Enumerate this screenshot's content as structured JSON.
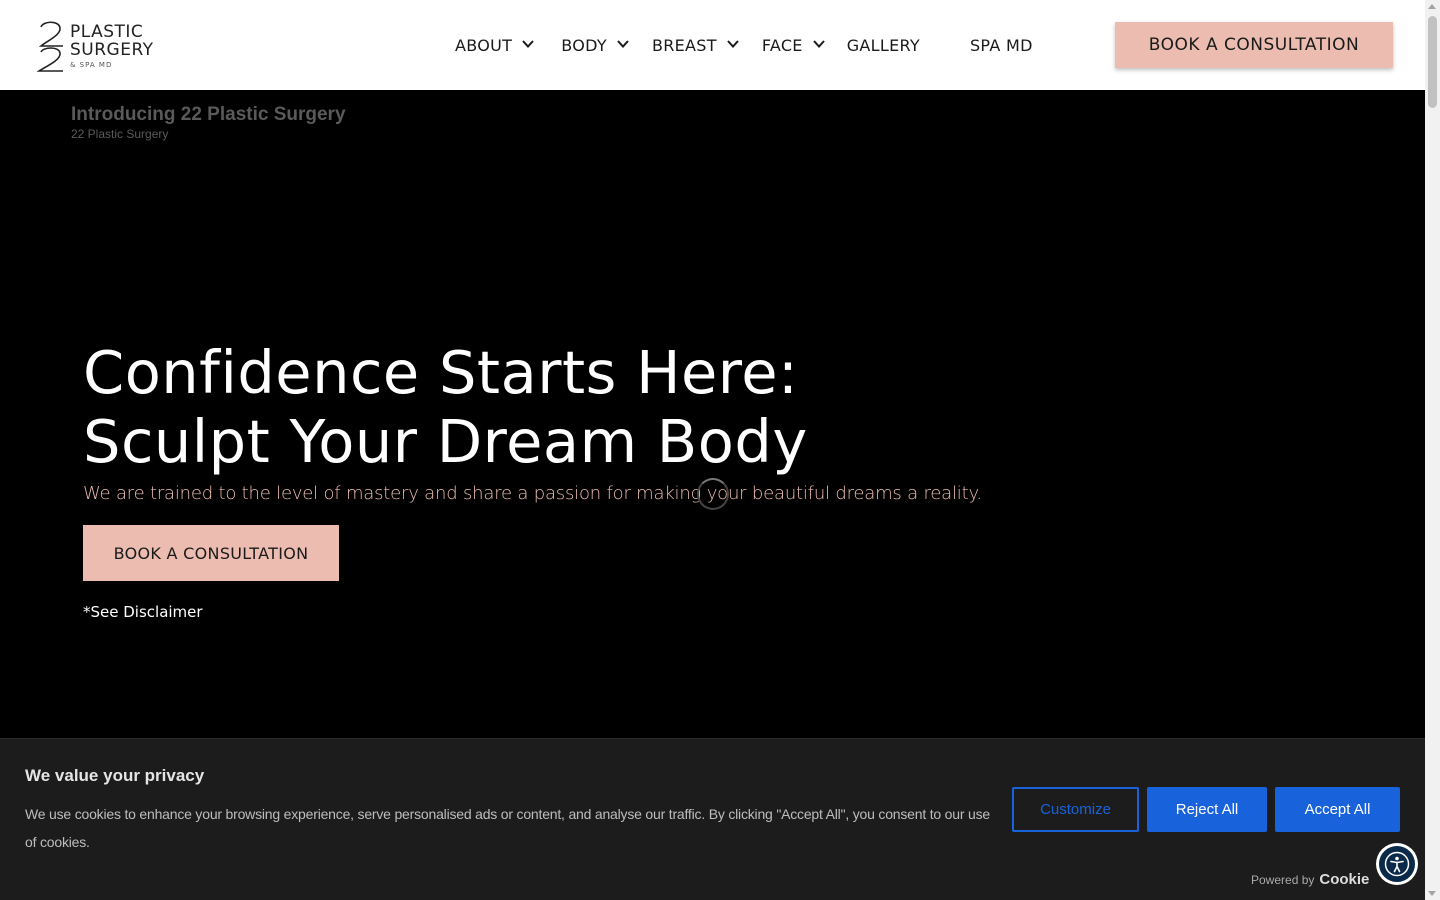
{
  "header": {
    "logo": {
      "mark": "22",
      "line1": "PLASTIC",
      "line2": "SURGERY",
      "line3": "& SPA MD"
    },
    "nav": [
      {
        "label": "ABOUT",
        "has_dropdown": true
      },
      {
        "label": "BODY",
        "has_dropdown": true
      },
      {
        "label": "BREAST",
        "has_dropdown": true
      },
      {
        "label": "FACE",
        "has_dropdown": true
      },
      {
        "label": "GALLERY",
        "has_dropdown": false
      },
      {
        "label": "SPA MD",
        "has_dropdown": false
      }
    ],
    "cta_label": "BOOK A CONSULTATION",
    "cta_color": "#ebbcaf"
  },
  "hero": {
    "video_title": "Introducing 22 Plastic Surgery",
    "video_channel": "22 Plastic Surgery",
    "headline_line1": "Confidence Starts Here:",
    "headline_line2": "Sculpt Your Dream Body",
    "tagline": "We are trained to the level of mastery and share a passion for making your beautiful dreams a reality.",
    "cta_label": "BOOK A CONSULTATION",
    "disclaimer": "*See Disclaimer",
    "loading_icon": "spinner-icon"
  },
  "cookie_banner": {
    "title": "We value your privacy",
    "text": "We use cookies to enhance your browsing experience, serve personalised ads or content, and analyse our traffic. By clicking \"Accept All\", you consent to our use of cookies.",
    "customize_label": "Customize",
    "reject_label": "Reject All",
    "accept_label": "Accept All",
    "powered_by": "Powered by",
    "powered_brand": "Cookie",
    "button_color": "#1863dc"
  },
  "accessibility": {
    "icon": "accessibility-icon"
  }
}
